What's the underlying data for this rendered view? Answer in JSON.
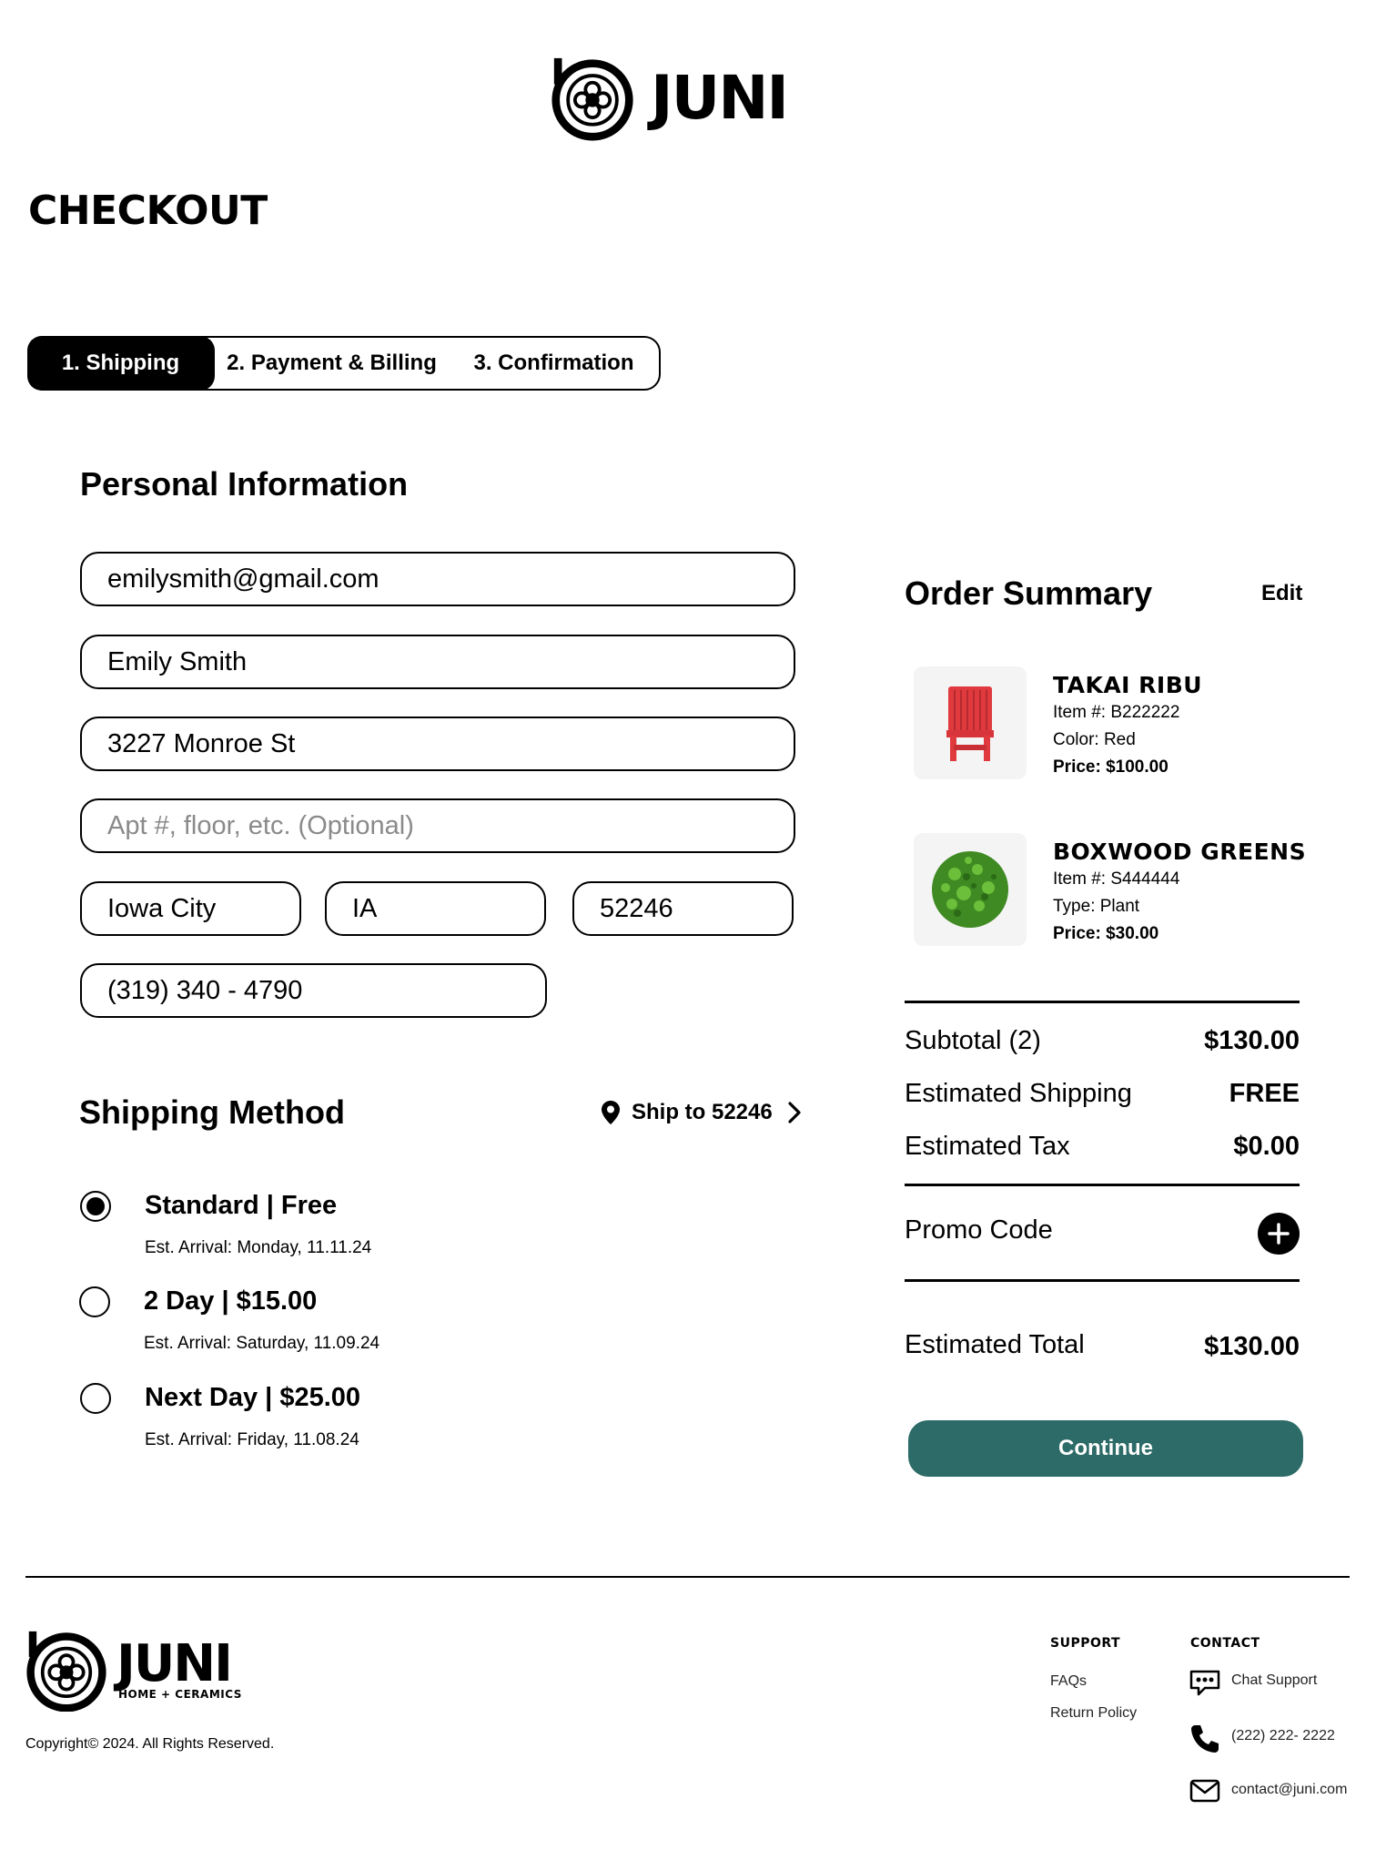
{
  "brand": {
    "name": "JUNI",
    "tagline": "HOME + CERAMICS"
  },
  "page_title": "CHECKOUT",
  "steps": [
    {
      "label": "1. Shipping",
      "active": true
    },
    {
      "label": "2. Payment & Billing",
      "active": false
    },
    {
      "label": "3. Confirmation",
      "active": false
    }
  ],
  "personal": {
    "heading": "Personal Information",
    "email": "emilysmith@gmail.com",
    "name": "Emily Smith",
    "address": "3227 Monroe St",
    "apt_placeholder": "Apt #, floor, etc. (Optional)",
    "city": "Iowa City",
    "state": "IA",
    "zip": "52246",
    "phone": "(319) 340 - 4790"
  },
  "shipping": {
    "heading": "Shipping Method",
    "ship_to": "Ship to 52246",
    "options": [
      {
        "title": "Standard | Free",
        "arrival": "Est. Arrival: Monday, 11.11.24",
        "selected": true
      },
      {
        "title": "2 Day | $15.00",
        "arrival": "Est. Arrival: Saturday, 11.09.24",
        "selected": false
      },
      {
        "title": "Next Day | $25.00",
        "arrival": "Est. Arrival: Friday, 11.08.24",
        "selected": false
      }
    ]
  },
  "summary": {
    "heading": "Order Summary",
    "edit": "Edit",
    "items": [
      {
        "name": "TAKAI RIBU",
        "item_no": "Item #: B222222",
        "detail": "Color: Red",
        "price": "Price: $100.00"
      },
      {
        "name": "BOXWOOD GREENS",
        "item_no": "Item #: S444444",
        "detail": "Type: Plant",
        "price": "Price: $30.00"
      }
    ],
    "subtotal_label": "Subtotal (2)",
    "subtotal": "$130.00",
    "shipping_label": "Estimated Shipping",
    "shipping": "FREE",
    "tax_label": "Estimated Tax",
    "tax": "$0.00",
    "promo_label": "Promo Code",
    "total_label": "Estimated Total",
    "total": "$130.00",
    "continue": "Continue",
    "colors": {
      "continue_bg": "#2c6b67",
      "pot": "#e03a3f",
      "plant": "#4a9a2a"
    }
  },
  "footer": {
    "copyright": "Copyright© 2024. All Rights Reserved.",
    "support_heading": "SUPPORT",
    "support_links": [
      "FAQs",
      "Return Policy"
    ],
    "contact_heading": "CONTACT",
    "chat": "Chat Support",
    "phone": "(222) 222- 2222",
    "email": "contact@juni.com"
  }
}
